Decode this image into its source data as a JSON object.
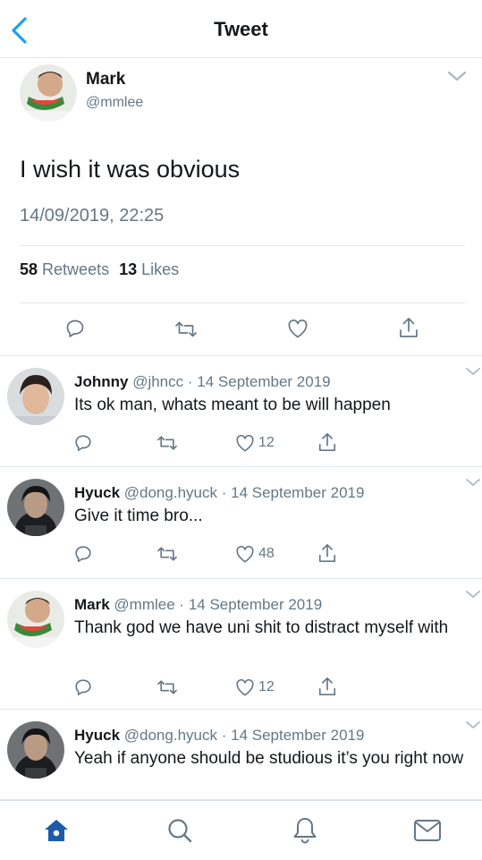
{
  "header": {
    "title": "Tweet"
  },
  "tweet": {
    "name": "Mark",
    "handle": "@mmlee",
    "text": "I wish it was obvious",
    "timestamp": "14/09/2019, 22:25",
    "retweets_count": "58",
    "retweets_label": "Retweets",
    "likes_count": "13",
    "likes_label": "Likes"
  },
  "replies": [
    {
      "name": "Johnny",
      "handle": "@jhncc",
      "sep": "·",
      "date": "14 September 2019",
      "text": "Its ok man, whats meant to be will happen",
      "likes": "12"
    },
    {
      "name": "Hyuck",
      "handle": "@dong.hyuck",
      "sep": "·",
      "date": "14 September 2019",
      "text": "Give it time bro...",
      "likes": "48"
    },
    {
      "name": "Mark",
      "handle": "@mmlee",
      "sep": "·",
      "date": "14 September 2019",
      "text": "Thank god we have uni shit to distract myself with",
      "likes": "12"
    },
    {
      "name": "Hyuck",
      "handle": "@dong.hyuck",
      "sep": "·",
      "date": "14 September 2019",
      "text": "Yeah if anyone should be studious it’s you right now",
      "likes": ""
    }
  ],
  "icons": {
    "back": "chevron-left-icon",
    "caret": "chevron-down-icon",
    "reply": "comment-icon",
    "retweet": "retweet-icon",
    "like": "heart-icon",
    "share": "share-icon",
    "home": "home-icon",
    "search": "search-icon",
    "notifications": "bell-icon",
    "messages": "mail-icon"
  },
  "colors": {
    "accent": "#1da1f2",
    "nav_active": "#1d5ba8",
    "gray": "#657786"
  }
}
